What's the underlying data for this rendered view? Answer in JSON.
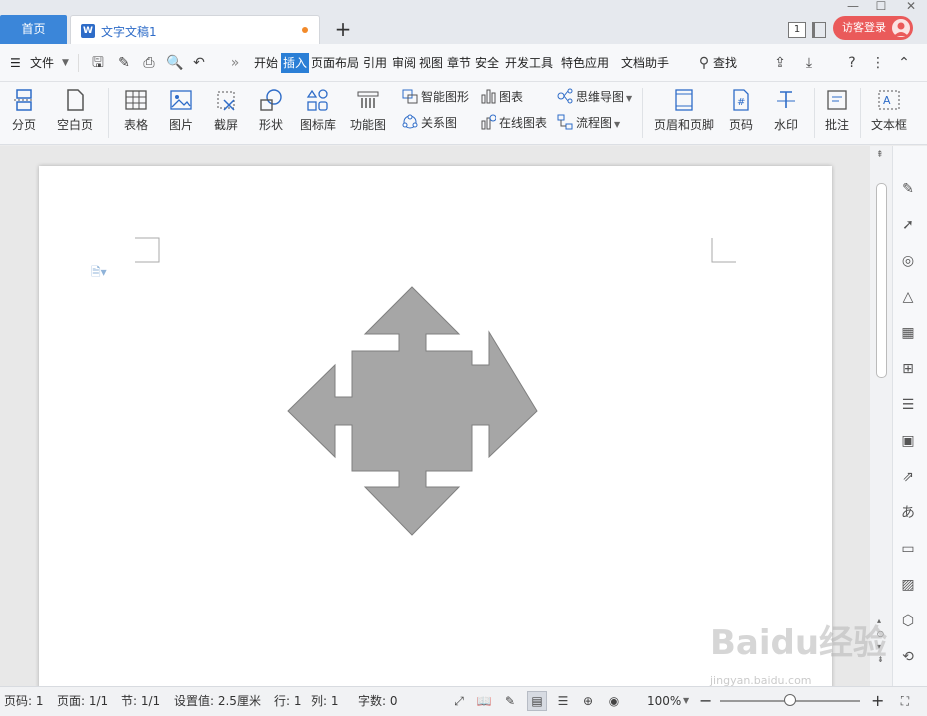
{
  "tabs": {
    "home": "首页",
    "doc": "文字文稿1",
    "new": "+"
  },
  "window": {
    "badge": "1",
    "login": "访客登录",
    "minimize": "—",
    "maximize": "☐",
    "close": "✕"
  },
  "menu": {
    "file": "文件",
    "items": [
      "开始",
      "插入",
      "页面布局",
      "引用",
      "审阅",
      "视图",
      "章节",
      "安全",
      "开发工具",
      "特色应用",
      "文档助手"
    ],
    "active": "插入",
    "search": "查找"
  },
  "ribbon": {
    "page_break": "分页",
    "blank_page": "空白页",
    "table": "表格",
    "picture": "图片",
    "screenshot": "截屏",
    "shape": "形状",
    "icon_lib": "图标库",
    "func_chart": "功能图",
    "smart_shape": "智能图形",
    "chart": "图表",
    "mind_map": "思维导图",
    "relation": "关系图",
    "online_chart": "在线图表",
    "flowchart": "流程图",
    "header_footer": "页眉和页脚",
    "page_num": "页码",
    "watermark": "水印",
    "comment": "批注",
    "textbox": "文本框"
  },
  "status": {
    "page_code": "页码: 1",
    "pages": "页面: 1/1",
    "section": "节: 1/1",
    "setting": "设置值: 2.5厘米",
    "row": "行: 1",
    "col": "列: 1",
    "words": "字数: 0",
    "zoom": "100%",
    "zoom_level": 0.5
  },
  "watermark": {
    "main": "Baidu经验",
    "sub": "jingyan.baidu.com"
  },
  "colors": {
    "accent": "#2b7fd6",
    "shape_fill": "#a6a6a6",
    "shape_stroke": "#7f7f7f",
    "login": "#ea5a5a"
  }
}
